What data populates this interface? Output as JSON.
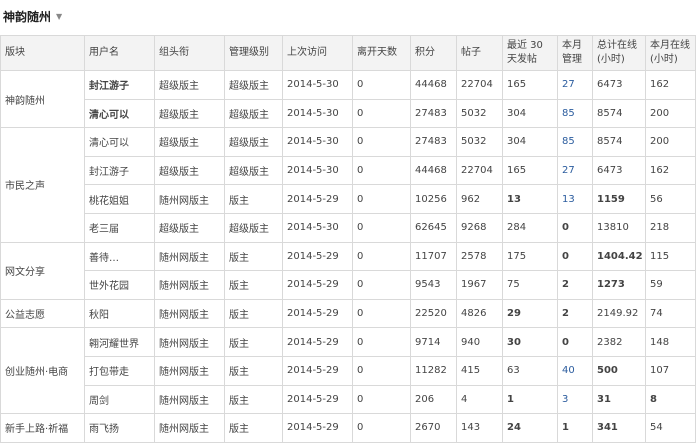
{
  "page": {
    "title": "神韵随州"
  },
  "table": {
    "headers": {
      "section": "版块",
      "username": "用户名",
      "group": "组头衔",
      "level": "管理级别",
      "last_visit": "上次访问",
      "days_away": "离开天数",
      "points": "积分",
      "posts": "帖子",
      "recent30_l1": "最近 30",
      "recent30_l2": "天发帖",
      "month_manage_l1": "本月",
      "month_manage_l2": "管理",
      "total_online_l1": "总计在线",
      "total_online_l2": "(小时)",
      "month_online_l1": "本月在线",
      "month_online_l2": "(小时)"
    },
    "sections": [
      {
        "name": "神韵随州",
        "rows": [
          {
            "user": "封江游子",
            "user_bold": true,
            "group": "超级版主",
            "level": "超级版主",
            "last": "2014-5-30",
            "days": "0",
            "points": "44468",
            "posts": "22704",
            "recent": "165",
            "recent_bold": false,
            "manage": "27",
            "manage_style": "link",
            "total": "6473",
            "total_bold": false,
            "month": "162",
            "month_bold": false
          },
          {
            "user": "清心可以",
            "user_bold": true,
            "group": "超级版主",
            "level": "超级版主",
            "last": "2014-5-30",
            "days": "0",
            "points": "27483",
            "posts": "5032",
            "recent": "304",
            "recent_bold": false,
            "manage": "85",
            "manage_style": "link",
            "total": "8574",
            "total_bold": false,
            "month": "200",
            "month_bold": false
          }
        ]
      },
      {
        "name": "市民之声",
        "rows": [
          {
            "user": "清心可以",
            "user_bold": false,
            "group": "超级版主",
            "level": "超级版主",
            "last": "2014-5-30",
            "days": "0",
            "points": "27483",
            "posts": "5032",
            "recent": "304",
            "recent_bold": false,
            "manage": "85",
            "manage_style": "link",
            "total": "8574",
            "total_bold": false,
            "month": "200",
            "month_bold": false
          },
          {
            "user": "封江游子",
            "user_bold": false,
            "group": "超级版主",
            "level": "超级版主",
            "last": "2014-5-30",
            "days": "0",
            "points": "44468",
            "posts": "22704",
            "recent": "165",
            "recent_bold": false,
            "manage": "27",
            "manage_style": "link",
            "total": "6473",
            "total_bold": false,
            "month": "162",
            "month_bold": false
          },
          {
            "user": "桃花姐姐",
            "user_bold": false,
            "group": "随州网版主",
            "level": "版主",
            "last": "2014-5-29",
            "days": "0",
            "points": "10256",
            "posts": "962",
            "recent": "13",
            "recent_bold": true,
            "manage": "13",
            "manage_style": "link",
            "total": "1159",
            "total_bold": true,
            "month": "56",
            "month_bold": false
          },
          {
            "user": "老三届",
            "user_bold": false,
            "group": "超级版主",
            "level": "超级版主",
            "last": "2014-5-30",
            "days": "0",
            "points": "62645",
            "posts": "9268",
            "recent": "284",
            "recent_bold": false,
            "manage": "0",
            "manage_style": "bold",
            "total": "13810",
            "total_bold": false,
            "month": "218",
            "month_bold": false
          }
        ]
      },
      {
        "name": "网文分享",
        "rows": [
          {
            "user": "善待…",
            "user_bold": false,
            "group": "随州网版主",
            "level": "版主",
            "last": "2014-5-29",
            "days": "0",
            "points": "11707",
            "posts": "2578",
            "recent": "175",
            "recent_bold": false,
            "manage": "0",
            "manage_style": "bold",
            "total": "1404.42",
            "total_bold": true,
            "month": "115",
            "month_bold": false
          },
          {
            "user": "世外花园",
            "user_bold": false,
            "group": "随州网版主",
            "level": "版主",
            "last": "2014-5-29",
            "days": "0",
            "points": "9543",
            "posts": "1967",
            "recent": "75",
            "recent_bold": false,
            "manage": "2",
            "manage_style": "bold",
            "total": "1273",
            "total_bold": true,
            "month": "59",
            "month_bold": false
          }
        ]
      },
      {
        "name": "公益志愿",
        "rows": [
          {
            "user": "秋阳",
            "user_bold": false,
            "group": "随州网版主",
            "level": "版主",
            "last": "2014-5-29",
            "days": "0",
            "points": "22520",
            "posts": "4826",
            "recent": "29",
            "recent_bold": true,
            "manage": "2",
            "manage_style": "bold",
            "total": "2149.92",
            "total_bold": false,
            "month": "74",
            "month_bold": false
          }
        ]
      },
      {
        "name": "创业随州·电商",
        "rows": [
          {
            "user": "翱河耀世界",
            "user_bold": false,
            "group": "随州网版主",
            "level": "版主",
            "last": "2014-5-29",
            "days": "0",
            "points": "9714",
            "posts": "940",
            "recent": "30",
            "recent_bold": true,
            "manage": "0",
            "manage_style": "bold",
            "total": "2382",
            "total_bold": false,
            "month": "148",
            "month_bold": false
          },
          {
            "user": "打包带走",
            "user_bold": false,
            "group": "随州网版主",
            "level": "版主",
            "last": "2014-5-29",
            "days": "0",
            "points": "11282",
            "posts": "415",
            "recent": "63",
            "recent_bold": false,
            "manage": "40",
            "manage_style": "link",
            "total": "500",
            "total_bold": true,
            "month": "107",
            "month_bold": false
          },
          {
            "user": "周剑",
            "user_bold": false,
            "group": "随州网版主",
            "level": "版主",
            "last": "2014-5-29",
            "days": "0",
            "points": "206",
            "posts": "4",
            "recent": "1",
            "recent_bold": true,
            "manage": "3",
            "manage_style": "link",
            "total": "31",
            "total_bold": true,
            "month": "8",
            "month_bold": true
          }
        ]
      },
      {
        "name": "新手上路·祈福",
        "rows": [
          {
            "user": "雨飞扬",
            "user_bold": false,
            "group": "随州网版主",
            "level": "版主",
            "last": "2014-5-29",
            "days": "0",
            "points": "2670",
            "posts": "143",
            "recent": "24",
            "recent_bold": true,
            "manage": "1",
            "manage_style": "bold",
            "total": "341",
            "total_bold": true,
            "month": "54",
            "month_bold": false
          }
        ]
      }
    ]
  }
}
